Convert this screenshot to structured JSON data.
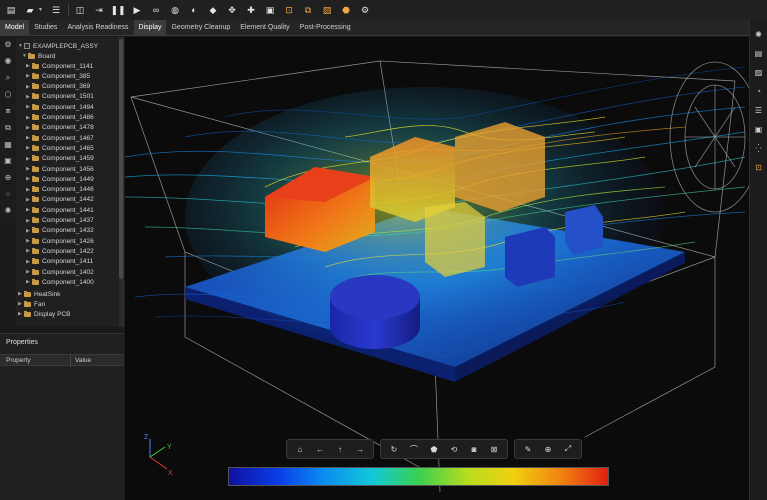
{
  "toolbar": {
    "buttons": [
      "new-file-icon",
      "open-folder-icon",
      "menu-icon",
      "split-view-icon",
      "export-icon",
      "pause-icon",
      "play-icon",
      "link-icon",
      "mesh-sphere-icon",
      "sphere-split-icon",
      "cube-icon",
      "move-icon",
      "transform-icon",
      "box-select-icon",
      "target-box-icon",
      "bounding-box-icon",
      "highlight-box-icon",
      "component-icon",
      "settings-sphere-icon"
    ]
  },
  "tabs": [
    "Model",
    "Studies",
    "Analysis Readiness",
    "Display",
    "Geometry Cleanup",
    "Element Quality",
    "Post-Processing"
  ],
  "active_tab": "Display",
  "tree": {
    "root": "EXAMPLEPCB_ASSY",
    "board": "Board",
    "components": [
      "Component_1141",
      "Component_385",
      "Component_369",
      "Component_1501",
      "Component_1494",
      "Component_1486",
      "Component_1478",
      "Component_1467",
      "Component_1465",
      "Component_1459",
      "Component_1456",
      "Component_1449",
      "Component_1446",
      "Component_1442",
      "Component_1441",
      "Component_1437",
      "Component_1432",
      "Component_1426",
      "Component_1422",
      "Component_1411",
      "Component_1402",
      "Component_1400"
    ],
    "other_nodes": [
      "HeatSink",
      "Fan",
      "Display PCB"
    ]
  },
  "properties": {
    "title": "Properties",
    "col_property": "Property",
    "col_value": "Value"
  },
  "axes": {
    "x": "X",
    "y": "Y",
    "z": "Z"
  },
  "colors": {
    "accent": "#f0a640",
    "colorbar_stops": [
      "#1010a0",
      "#0a3ee8",
      "#0a8cf0",
      "#12c8d8",
      "#3ad050",
      "#b8dc20",
      "#f0d010",
      "#f08010",
      "#e02010"
    ]
  }
}
